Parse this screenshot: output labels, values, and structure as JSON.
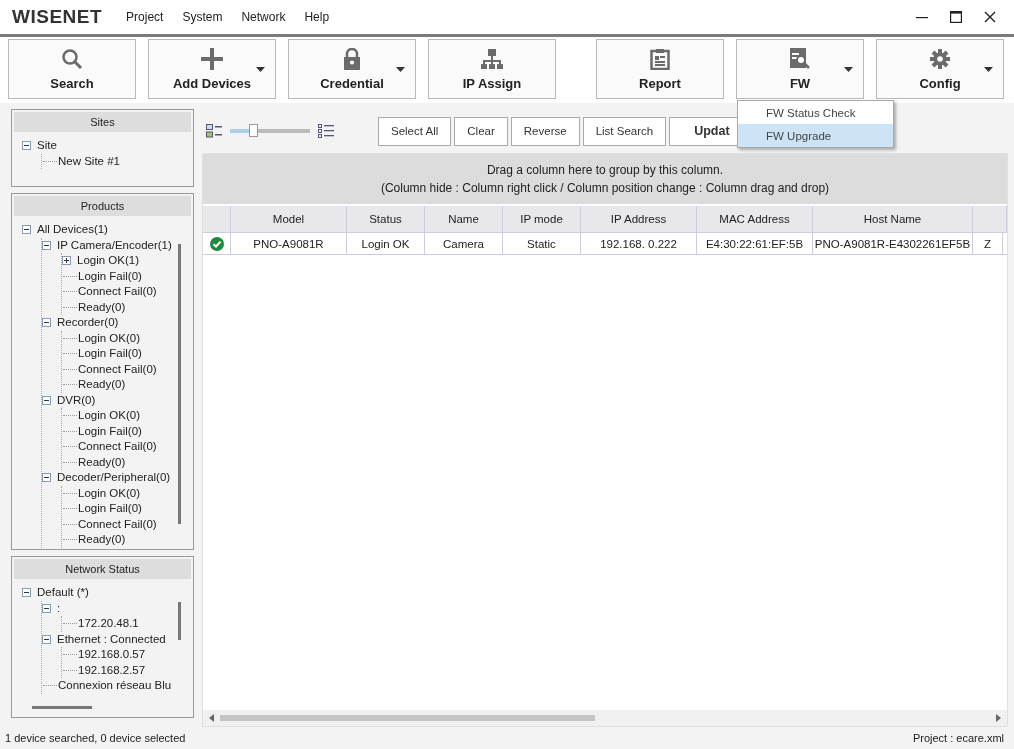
{
  "window": {
    "logo": "WISENET",
    "menu": [
      "Project",
      "System",
      "Network",
      "Help"
    ]
  },
  "toolbar": {
    "left": [
      {
        "label": "Search",
        "dropdown": false
      },
      {
        "label": "Add Devices",
        "dropdown": true
      },
      {
        "label": "Credential",
        "dropdown": true
      },
      {
        "label": "IP Assign",
        "dropdown": false
      }
    ],
    "right": [
      {
        "label": "Report",
        "dropdown": false
      },
      {
        "label": "FW",
        "dropdown": true
      },
      {
        "label": "Config",
        "dropdown": true
      }
    ]
  },
  "fw_menu": [
    {
      "label": "FW Status Check",
      "selected": false
    },
    {
      "label": "FW Upgrade",
      "selected": true
    }
  ],
  "sites": {
    "title": "Sites",
    "tree": [
      {
        "label": "Site",
        "expanded": true,
        "children": [
          {
            "label": "New Site #1"
          }
        ]
      }
    ]
  },
  "products": {
    "title": "Products",
    "tree": [
      {
        "label": "All Devices(1)",
        "expanded": true,
        "children": [
          {
            "label": "IP Camera/Encoder(1)",
            "expanded": true,
            "children": [
              {
                "label": "Login OK(1)",
                "expanded": false
              },
              {
                "label": "Login Fail(0)"
              },
              {
                "label": "Connect Fail(0)"
              },
              {
                "label": "Ready(0)"
              }
            ]
          },
          {
            "label": "Recorder(0)",
            "expanded": true,
            "children": [
              {
                "label": "Login OK(0)"
              },
              {
                "label": "Login Fail(0)"
              },
              {
                "label": "Connect Fail(0)"
              },
              {
                "label": "Ready(0)"
              }
            ]
          },
          {
            "label": "DVR(0)",
            "expanded": true,
            "children": [
              {
                "label": "Login OK(0)"
              },
              {
                "label": "Login Fail(0)"
              },
              {
                "label": "Connect Fail(0)"
              },
              {
                "label": "Ready(0)"
              }
            ]
          },
          {
            "label": "Decoder/Peripheral(0)",
            "expanded": true,
            "children": [
              {
                "label": "Login OK(0)"
              },
              {
                "label": "Login Fail(0)"
              },
              {
                "label": "Connect Fail(0)"
              },
              {
                "label": "Ready(0)"
              }
            ]
          }
        ]
      }
    ]
  },
  "network_status": {
    "title": "Network Status",
    "tree": [
      {
        "label": "Default (*)",
        "expanded": true,
        "children": [
          {
            "label": ":",
            "expanded": true,
            "children": [
              {
                "label": "172.20.48.1"
              }
            ]
          },
          {
            "label": "Ethernet : Connected",
            "expanded": true,
            "children": [
              {
                "label": "192.168.0.57"
              },
              {
                "label": "192.168.2.57"
              }
            ]
          },
          {
            "label": "Connexion réseau Blu"
          }
        ]
      }
    ]
  },
  "view_slider": {
    "level": 0.3
  },
  "list_buttons": [
    "Select All",
    "Clear",
    "Reverse",
    "List Search",
    "Updat"
  ],
  "group_hint": [
    "Drag a column here to group by this column.",
    "(Column hide : Column right click / Column position change : Column drag and drop)"
  ],
  "table": {
    "columns": [
      "Model",
      "Status",
      "Name",
      "IP mode",
      "IP Address",
      "MAC Address",
      "Host Name"
    ],
    "rows": [
      {
        "checked": true,
        "cells": [
          "PNO-A9081R",
          "Login OK",
          "Camera",
          "Static",
          "192.168.     0.222",
          "E4:30:22:61:EF:5B",
          "PNO-A9081R-E4302261EF5B",
          "Z"
        ]
      }
    ]
  },
  "status_bar": {
    "left": "1 device searched, 0 device selected",
    "right": "Project : ecare.xml"
  }
}
